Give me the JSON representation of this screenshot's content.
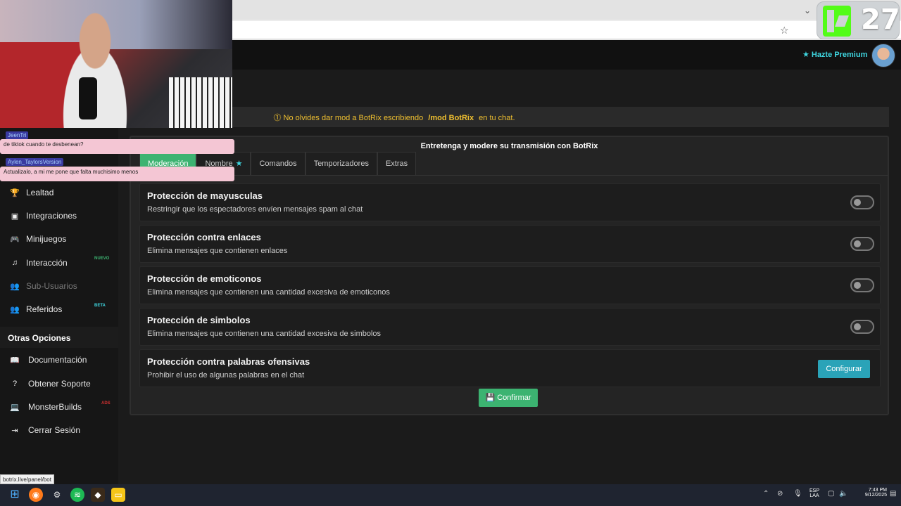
{
  "kick": {
    "count": "27"
  },
  "chat": [
    {
      "user": "JeenTri",
      "message": "de tiktok cuando te desbenean?"
    },
    {
      "user": "Aylen_TaylorsVersion",
      "message": "Actualizalo, a mi me pone que falta muchisimo menos"
    }
  ],
  "header": {
    "premium_label": "Hazte Premium"
  },
  "notice": {
    "prefix": "No olvides dar mod a BotRix escribiendo",
    "command": "/mod BotRix",
    "suffix": "en tu chat."
  },
  "panel": {
    "title": "Entretenga y modere su transmisión con BotRix",
    "tabs": [
      {
        "label": "Moderación"
      },
      {
        "label": "Nombre"
      },
      {
        "label": "Comandos"
      },
      {
        "label": "Temporizadores"
      },
      {
        "label": "Extras"
      }
    ],
    "rows": [
      {
        "title": "Protección de mayusculas",
        "desc": "Restringir que los espectadores envíen mensajes spam al chat"
      },
      {
        "title": "Protección contra enlaces",
        "desc": "Elimina mensajes que contienen enlaces"
      },
      {
        "title": "Protección de emoticonos",
        "desc": "Elimina mensajes que contienen una cantidad excesiva de emoticonos"
      },
      {
        "title": "Protección de simbolos",
        "desc": "Elimina mensajes que contienen una cantidad excesiva de simbolos"
      },
      {
        "title": "Protección contra palabras ofensivas",
        "desc": "Prohibir el uso de algunas palabras en el chat"
      }
    ],
    "configure_label": "Configurar",
    "confirm_label": "Confirmar"
  },
  "sidebar": {
    "items": [
      {
        "label": "Lealtad",
        "icon": "trophy-icon"
      },
      {
        "label": "Integraciones",
        "icon": "discord-icon"
      },
      {
        "label": "Minijuegos",
        "icon": "gamepad-icon"
      },
      {
        "label": "Interacción",
        "icon": "music-icon",
        "badge": "NUEVO"
      },
      {
        "label": "Sub-Usuarios",
        "icon": "users-icon"
      },
      {
        "label": "Referidos",
        "icon": "users-icon",
        "badge": "BETA"
      }
    ],
    "other_heading": "Otras Opciones",
    "other_items": [
      {
        "label": "Documentación",
        "icon": "book-icon"
      },
      {
        "label": "Obtener Soporte",
        "icon": "question-icon"
      },
      {
        "label": "MonsterBuilds",
        "icon": "laptop-icon",
        "badge": "ADS"
      },
      {
        "label": "Cerrar Sesión",
        "icon": "sign-out-icon"
      }
    ]
  },
  "status_url": "botrix.live/panel/bot",
  "taskbar": {
    "lang1": "ESP",
    "lang2": "LAA",
    "time": "7:43 PM",
    "date": "9/12/2025"
  },
  "colors": {
    "accent_green": "#3cb371",
    "accent_cyan": "#3fd6e0",
    "notice_yellow": "#f0c030"
  }
}
